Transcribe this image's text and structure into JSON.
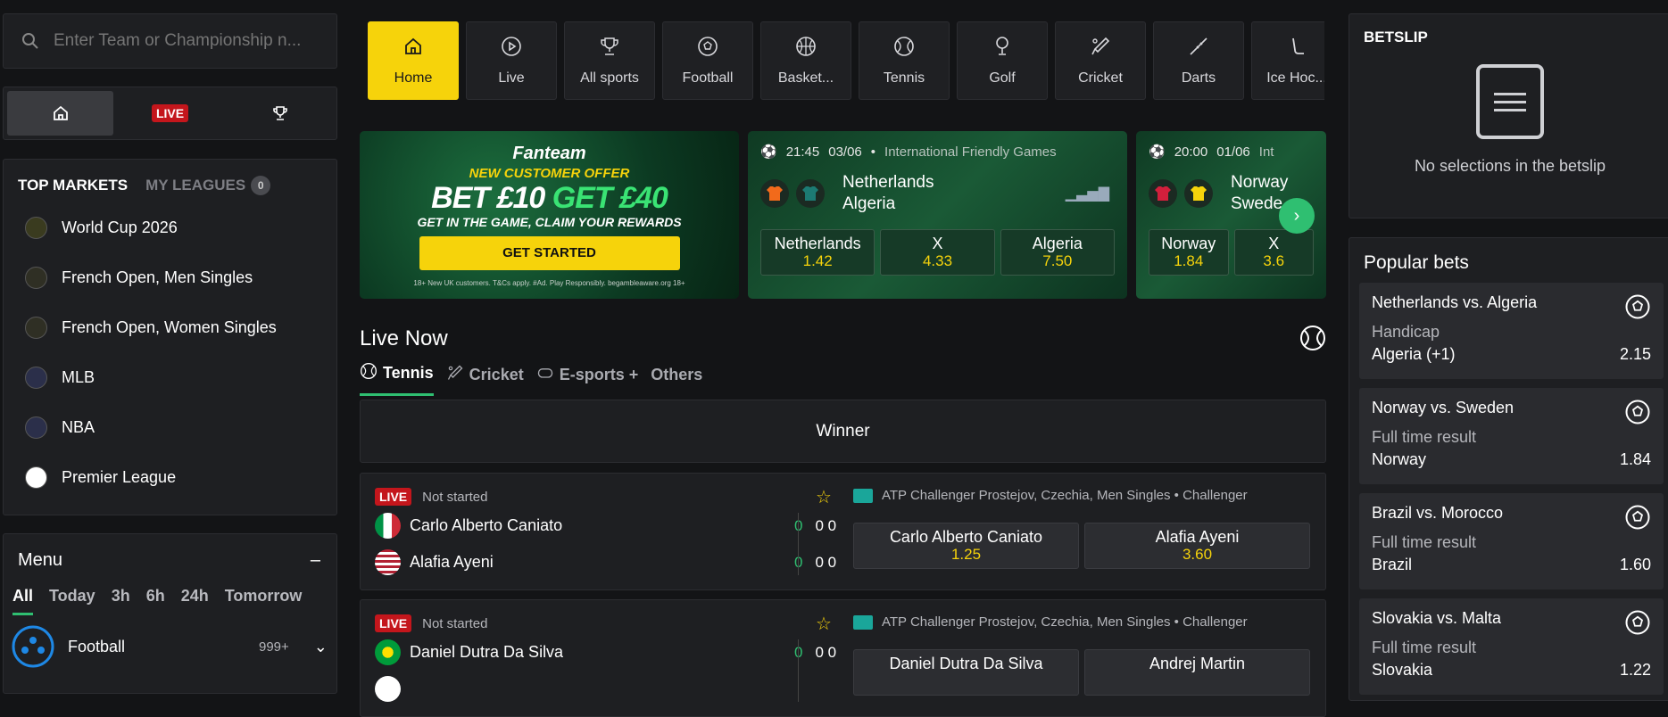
{
  "search": {
    "placeholder": "Enter Team or Championship n..."
  },
  "quick": {
    "live_label": "LIVE"
  },
  "markets": {
    "tab_top": "TOP MARKETS",
    "tab_leagues": "MY LEAGUES",
    "leagues_count": "0",
    "items": [
      {
        "label": "World Cup 2026",
        "icon": "world-cup-icon",
        "color": "#3a3b1f"
      },
      {
        "label": "French Open, Men Singles",
        "icon": "tennis-ball-icon",
        "color": "#2f2f24"
      },
      {
        "label": "French Open, Women Singles",
        "icon": "tennis-ball-icon",
        "color": "#2f2f24"
      },
      {
        "label": "MLB",
        "icon": "mlb-icon",
        "color": "#2b2f4a"
      },
      {
        "label": "NBA",
        "icon": "nba-icon",
        "color": "#2b2f4a"
      },
      {
        "label": "Premier League",
        "icon": "england-flag-icon",
        "color": "#ffffff"
      }
    ]
  },
  "menu": {
    "title": "Menu",
    "collapse": "–",
    "filters": [
      "All",
      "Today",
      "3h",
      "6h",
      "24h",
      "Tomorrow"
    ],
    "sport": "Football",
    "sport_count": "999+"
  },
  "nav": [
    {
      "label": "Home",
      "icon": "home-icon"
    },
    {
      "label": "Live",
      "icon": "play-icon"
    },
    {
      "label": "All sports",
      "icon": "trophy-icon"
    },
    {
      "label": "Football",
      "icon": "football-icon"
    },
    {
      "label": "Basket...",
      "icon": "basketball-icon"
    },
    {
      "label": "Tennis",
      "icon": "tennis-icon"
    },
    {
      "label": "Golf",
      "icon": "golf-icon"
    },
    {
      "label": "Cricket",
      "icon": "cricket-icon"
    },
    {
      "label": "Darts",
      "icon": "darts-icon"
    },
    {
      "label": "Ice Hoc...",
      "icon": "hockey-icon"
    }
  ],
  "promo": {
    "brand": "Fanteam",
    "offer": "NEW CUSTOMER OFFER",
    "bet": "BET £10",
    "get": "GET £40",
    "sub": "GET IN THE GAME, CLAIM YOUR REWARDS",
    "cta": "GET STARTED",
    "fine": "18+ New UK customers. T&Cs apply. #Ad. Play Responsibly. begambleaware.org 18+"
  },
  "cards": [
    {
      "time": "21:45",
      "date": "03/06",
      "comp": "International Friendly Games",
      "home": "Netherlands",
      "away": "Algeria",
      "o1l": "Netherlands",
      "o1": "1.42",
      "oxl": "X",
      "ox": "4.33",
      "o2l": "Algeria",
      "o2": "7.50"
    },
    {
      "time": "20:00",
      "date": "01/06",
      "comp": "Int",
      "home": "Norway",
      "away": "Swede",
      "o1l": "Norway",
      "o1": "1.84",
      "oxl": "X",
      "ox": "3.6"
    }
  ],
  "live": {
    "title": "Live Now",
    "tabs": [
      "Tennis",
      "Cricket",
      "E-sports +",
      "Others"
    ],
    "winner": "Winner"
  },
  "matches": [
    {
      "badge": "LIVE",
      "status": "Not started",
      "p1": "Carlo Alberto Caniato",
      "p2": "Alafia Ayeni",
      "s1a": "0",
      "s1b": "0 0",
      "s2a": "0",
      "s2b": "0 0",
      "league": "ATP Challenger Prostejov, Czechia, Men Singles • Challenger",
      "b1l": "Carlo Alberto Caniato",
      "b1": "1.25",
      "b2l": "Alafia Ayeni",
      "b2": "3.60"
    },
    {
      "badge": "LIVE",
      "status": "Not started",
      "p1": "Daniel Dutra Da Silva",
      "p2": "",
      "s1a": "0",
      "s1b": "0 0",
      "league": "ATP Challenger Prostejov, Czechia, Men Singles • Challenger",
      "b1l": "Daniel Dutra Da Silva",
      "b2l": "Andrej Martin"
    }
  ],
  "betslip": {
    "title": "BETSLIP",
    "empty": "No selections in the betslip"
  },
  "popular": {
    "title": "Popular bets",
    "items": [
      {
        "match": "Netherlands vs. Algeria",
        "market": "Handicap",
        "sel": "Algeria (+1)",
        "odd": "2.15"
      },
      {
        "match": "Norway vs. Sweden",
        "market": "Full time result",
        "sel": "Norway",
        "odd": "1.84"
      },
      {
        "match": "Brazil vs. Morocco",
        "market": "Full time result",
        "sel": "Brazil",
        "odd": "1.60"
      },
      {
        "match": "Slovakia vs. Malta",
        "market": "Full time result",
        "sel": "Slovakia",
        "odd": "1.22"
      }
    ]
  }
}
